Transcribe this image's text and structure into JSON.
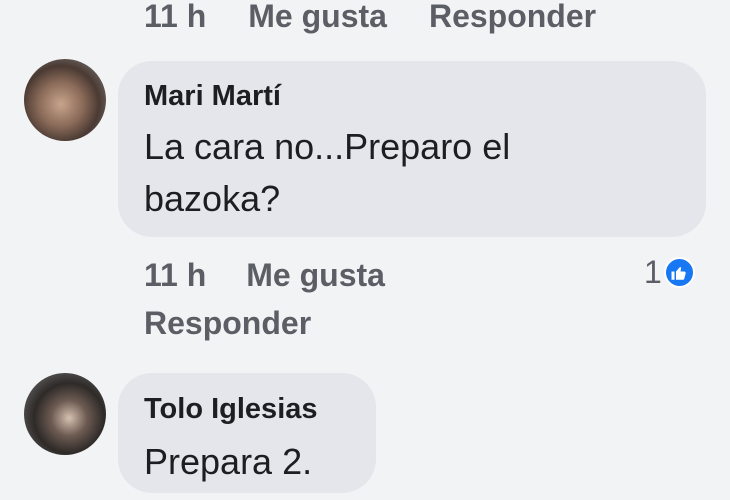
{
  "top_actions": {
    "time": "11 h",
    "like": "Me gusta",
    "reply": "Responder"
  },
  "comments": [
    {
      "author": "Mari Martí",
      "text": "La cara no...Preparo el bazoka?",
      "time": "11 h",
      "like": "Me gusta",
      "reply": "Responder",
      "reaction_count": "1",
      "reaction_icon": "like-icon",
      "reaction_color": "#1877f2"
    },
    {
      "author": "Tolo Iglesias",
      "text": "Prepara 2."
    }
  ]
}
